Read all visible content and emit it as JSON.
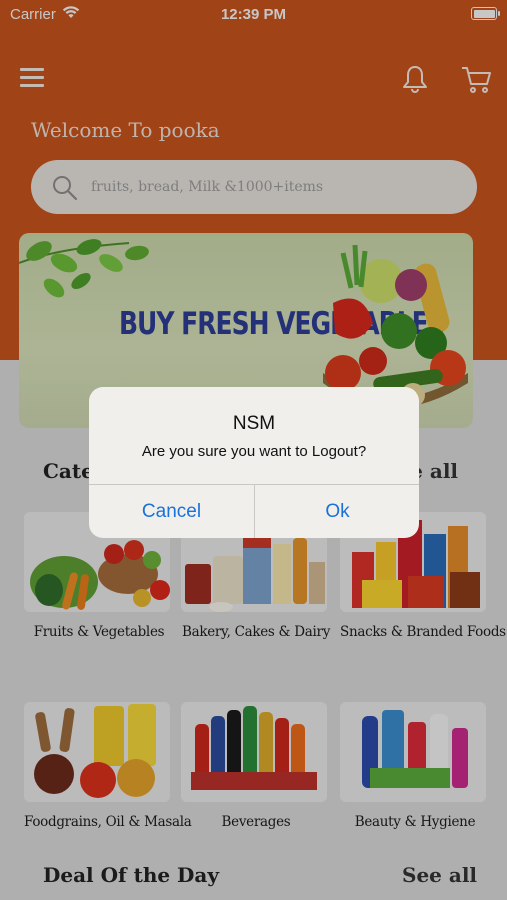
{
  "status_bar": {
    "carrier": "Carrier",
    "time": "12:39 PM"
  },
  "header": {
    "welcome": "Welcome To pooka"
  },
  "search": {
    "placeholder": "fruits, bread, Milk &1000+items"
  },
  "banner": {
    "title": "BUY FRESH VEGETABLES"
  },
  "categories_section": {
    "title": "Categories",
    "see_all": "See all"
  },
  "categories": [
    {
      "label": "Fruits & Vegetables"
    },
    {
      "label": "Bakery, Cakes & Dairy"
    },
    {
      "label": "Snacks & Branded Foods"
    },
    {
      "label": "Foodgrains, Oil & Masala"
    },
    {
      "label": "Beverages"
    },
    {
      "label": "Beauty & Hygiene"
    }
  ],
  "deal_section": {
    "title": "Deal Of the Day",
    "see_all": "See all"
  },
  "alert": {
    "title": "NSM",
    "message": "Are you sure you want to Logout?",
    "cancel": "Cancel",
    "ok": "Ok"
  },
  "colors": {
    "header": "#c4521c",
    "alert_button": "#1a72d9",
    "background": "#d6d6d6"
  }
}
